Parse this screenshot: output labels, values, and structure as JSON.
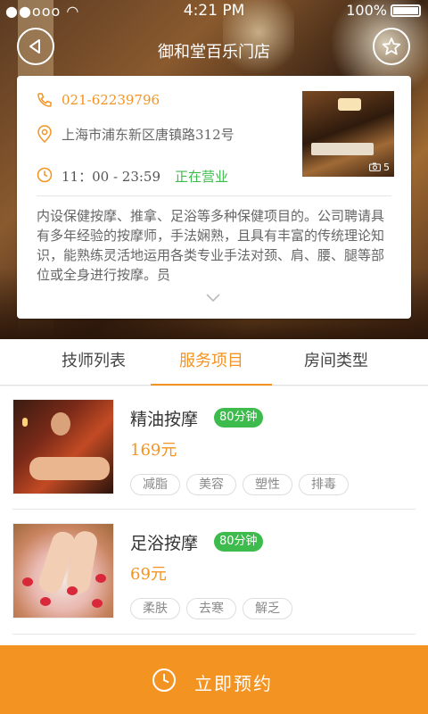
{
  "status": {
    "left": "●●ooo ◠",
    "time": "4:21 PM",
    "battery": "100%"
  },
  "header": {
    "title": "御和堂百乐门店",
    "back_icon": "back-arrow-icon",
    "fav_icon": "star-icon"
  },
  "info": {
    "phone": "021-62239796",
    "address": "上海市浦东新区唐镇路312号",
    "hours": "11：00 - 23:59",
    "open_status": "正在营业",
    "photo_count": "5",
    "description": "内设保健按摩、推拿、足浴等多种保健项目的。公司聘请具有多年经验的按摩师，手法娴熟，且具有丰富的传统理论知识，能熟练灵活地运用各类专业手法对颈、肩、腰、腿等部位或全身进行按摩。员"
  },
  "tabs": [
    {
      "label": "技师列表"
    },
    {
      "label": "服务项目"
    },
    {
      "label": "房间类型"
    }
  ],
  "services": [
    {
      "name": "精油按摩",
      "duration": "80分钟",
      "price": "169元",
      "tags": [
        "减脂",
        "美容",
        "塑性",
        "排毒"
      ]
    },
    {
      "name": "足浴按摩",
      "duration": "80分钟",
      "price": "69元",
      "tags": [
        "柔肤",
        "去寒",
        "解乏"
      ]
    }
  ],
  "cta": {
    "label": "立即预约"
  },
  "colors": {
    "accent": "#f39322",
    "open": "#3dbb4d"
  }
}
